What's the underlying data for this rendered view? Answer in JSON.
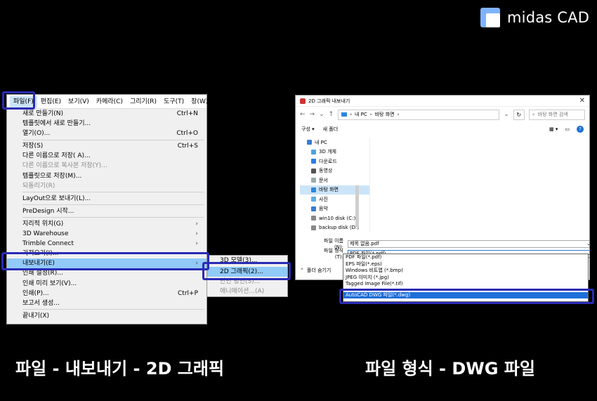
{
  "brand": {
    "name": "midas CAD"
  },
  "left_menu": {
    "menubar": [
      "파일(F)",
      "편집(E)",
      "보기(V)",
      "카메라(C)",
      "그리기(R)",
      "도구(T)",
      "창(W)"
    ],
    "items": [
      {
        "label": "새로 만들기(N)",
        "shortcut": "Ctrl+N"
      },
      {
        "label": "템플릿에서 새로 만들기..."
      },
      {
        "label": "열기(O)...",
        "shortcut": "Ctrl+O"
      },
      {
        "label": "저장(S)",
        "shortcut": "Ctrl+S"
      },
      {
        "label": "다른 이름으로 저장( A)..."
      },
      {
        "label": "다른 이름으로 복사본 저장(Y)..."
      },
      {
        "label": "템플릿으로 저장(M)..."
      },
      {
        "label": "되돌리기(R)"
      },
      {
        "label": "LayOut으로 보내기(L)..."
      },
      {
        "label": "PreDesign 시작..."
      },
      {
        "label": "지리적 위치(G)"
      },
      {
        "label": "3D Warehouse"
      },
      {
        "label": "Trimble Connect"
      },
      {
        "label": "가져오기(I)..."
      },
      {
        "label": "내보내기(E)"
      },
      {
        "label": "인쇄 설정(R)..."
      },
      {
        "label": "인쇄 미리 보기(V)..."
      },
      {
        "label": "인쇄(P)...",
        "shortcut": "Ctrl+P"
      },
      {
        "label": "보고서 생성..."
      },
      {
        "label": "끝내기(X)"
      }
    ],
    "submenu": [
      "3D 모델(3)...",
      "2D 그래픽(2)...",
      "단면 평면(S)...",
      "애니메이션...(A)"
    ]
  },
  "dialog": {
    "title": "2D 그래픽 내보내기",
    "breadcrumb": [
      "내 PC",
      "바탕 화면"
    ],
    "search_placeholder": "바탕 화면 검색",
    "toolbar": {
      "organize": "구성",
      "new_folder": "새 폴더"
    },
    "nav_items": [
      "내 PC",
      "3D 개체",
      "다운로드",
      "동영상",
      "문서",
      "바탕 화면",
      "사진",
      "음악",
      "win10 disk (C:)",
      "backup disk (D:)"
    ],
    "filename_label": "파일 이름(N):",
    "filename_value": "제목 없음.pdf",
    "filetype_label": "파일 형식(T):",
    "filetype_value": "PDF 파일(*.pdf)",
    "filetype_options": [
      "PDF 파일(*.pdf)",
      "EPS 파일(*.eps)",
      "Windows 비트맵 (*.bmp)",
      "JPEG 이미지 (*.jpg)",
      "Tagged Image File(*.tif)",
      "AutoCAD DWG 파일(*.dwg)"
    ],
    "hide_folders": "폴더 숨기기"
  },
  "captions": {
    "left": "파일 - 내보내기 - 2D 그래픽",
    "right": "파일 형식 - DWG 파일"
  },
  "colors": {
    "highlight": "#2a2bb5",
    "menu_selected": "#91c9f7",
    "dropdown_selected": "#1e6fd9"
  }
}
